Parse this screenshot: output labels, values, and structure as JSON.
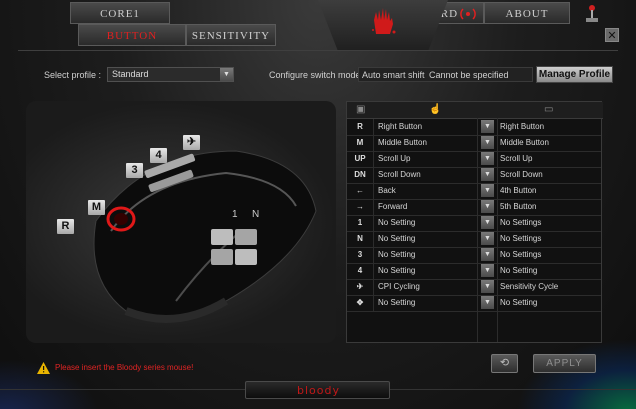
{
  "tabs": {
    "core": "CORE1",
    "button": "BUTTON",
    "sensitivity": "SENSITIVITY",
    "guard": "GUARD",
    "about": "ABOUT"
  },
  "profile": {
    "label": "Select profile :",
    "value": "Standard"
  },
  "configure": {
    "label": "Configure switch mode :",
    "mode": "Auto smart shift",
    "note": "Cannot be specified"
  },
  "manage_button": "Manage Profile",
  "mouse_keys": [
    "R",
    "M",
    "3",
    "4"
  ],
  "table": {
    "rows": [
      {
        "icon": "R",
        "function": "Right Button",
        "default": "Right Button"
      },
      {
        "icon": "M",
        "function": "Middle Button",
        "default": "Middle Button"
      },
      {
        "icon": "UP",
        "function": "Scroll Up",
        "default": "Scroll Up"
      },
      {
        "icon": "DN",
        "function": "Scroll Down",
        "default": "Scroll Down"
      },
      {
        "icon": "←",
        "function": "Back",
        "default": "4th Button"
      },
      {
        "icon": "→",
        "function": "Forward",
        "default": "5th Button"
      },
      {
        "icon": "1",
        "function": "No Setting",
        "default": "No Settings"
      },
      {
        "icon": "N",
        "function": "No Setting",
        "default": "No Settings"
      },
      {
        "icon": "3",
        "function": "No Setting",
        "default": "No Settings"
      },
      {
        "icon": "4",
        "function": "No Setting",
        "default": "No Setting"
      },
      {
        "icon": "✈",
        "function": "CPI Cycling",
        "default": "Sensitivity Cycle"
      },
      {
        "icon": "✥",
        "function": "No Setting",
        "default": "No Setting"
      }
    ]
  },
  "warning": "Please insert the Bloody series mouse!",
  "apply_button": "APPLY",
  "brand": "bloody",
  "colors": {
    "accent_red": "#e02020",
    "bg": "#1d1d1d"
  }
}
